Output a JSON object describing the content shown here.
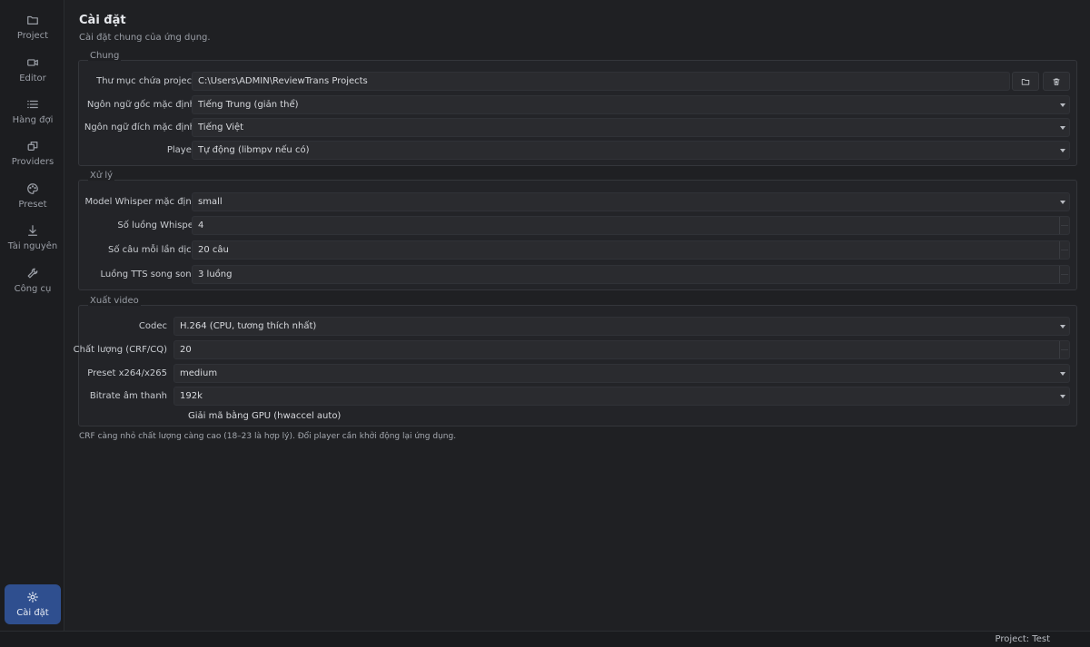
{
  "sidebar": {
    "items": [
      {
        "label": "Project",
        "icon": "folder-icon"
      },
      {
        "label": "Editor",
        "icon": "video-icon"
      },
      {
        "label": "Hàng đợi",
        "icon": "list-icon"
      },
      {
        "label": "Providers",
        "icon": "providers-icon"
      },
      {
        "label": "Preset",
        "icon": "palette-icon"
      },
      {
        "label": "Tài nguyên",
        "icon": "download-icon"
      },
      {
        "label": "Công cụ",
        "icon": "wrench-icon"
      }
    ],
    "settings": {
      "label": "Cài đặt",
      "icon": "gear-icon"
    }
  },
  "page": {
    "title": "Cài đặt",
    "subtitle": "Cài đặt chung của ứng dụng."
  },
  "general": {
    "title": "Chung",
    "project_dir_label": "Thư mục chứa project",
    "project_dir_value": "C:\\Users\\ADMIN\\ReviewTrans Projects",
    "src_lang_label": "Ngôn ngữ gốc mặc định",
    "src_lang_value": "Tiếng Trung (giản thể)",
    "dst_lang_label": "Ngôn ngữ đích mặc định",
    "dst_lang_value": "Tiếng Việt",
    "player_label": "Player",
    "player_value": "Tự động (libmpv nếu có)"
  },
  "processing": {
    "title": "Xử lý",
    "whisper_model_label": "Model Whisper mặc định",
    "whisper_model_value": "small",
    "whisper_threads_label": "Số luồng Whisper",
    "whisper_threads_value": "4",
    "batch_label": "Số câu mỗi lần dịch",
    "batch_value": "20 câu",
    "tts_label": "Luồng TTS song song",
    "tts_value": "3 luồng"
  },
  "export": {
    "title": "Xuất video",
    "codec_label": "Codec",
    "codec_value": "H.264 (CPU, tương thích nhất)",
    "quality_label": "Chất lượng (CRF/CQ)",
    "quality_value": "20",
    "preset_label": "Preset x264/x265",
    "preset_value": "medium",
    "bitrate_label": "Bitrate âm thanh",
    "bitrate_value": "192k",
    "gpu_decode_label": "Giải mã bằng GPU (hwaccel auto)"
  },
  "footnote": "CRF càng nhỏ chất lượng càng cao (18–23 là hợp lý). Đổi player cần khởi động lại ứng dụng.",
  "status": {
    "project": "Project: Test"
  }
}
